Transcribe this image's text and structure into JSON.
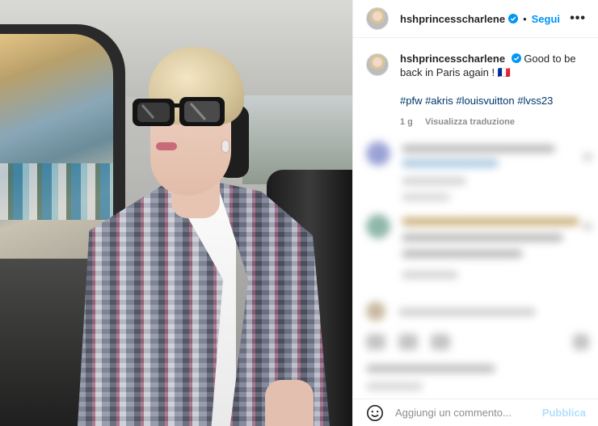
{
  "post": {
    "username": "hshprincesscharlene",
    "separator": "•",
    "follow_label": "Segui",
    "more_label": "•••",
    "caption": {
      "text": "Good to be back in Paris again ! 🇫🇷",
      "hashtags": "#pfw #akris #louisvuitton #lvss23",
      "time_ago": "1 g",
      "translate_label": "Visualizza traduzione"
    }
  },
  "comment_box": {
    "placeholder": "Aggiungi un commento...",
    "publish_label": "Pubblica"
  },
  "icons": {
    "avatar": "profile-avatar",
    "verified": "verified-badge-icon",
    "more": "more-options-icon",
    "emoji": "emoji-icon"
  },
  "colors": {
    "accent": "#0095f6",
    "hashtag": "#00376b",
    "muted": "#8e8e8e",
    "publish_disabled": "#b2dffc"
  }
}
